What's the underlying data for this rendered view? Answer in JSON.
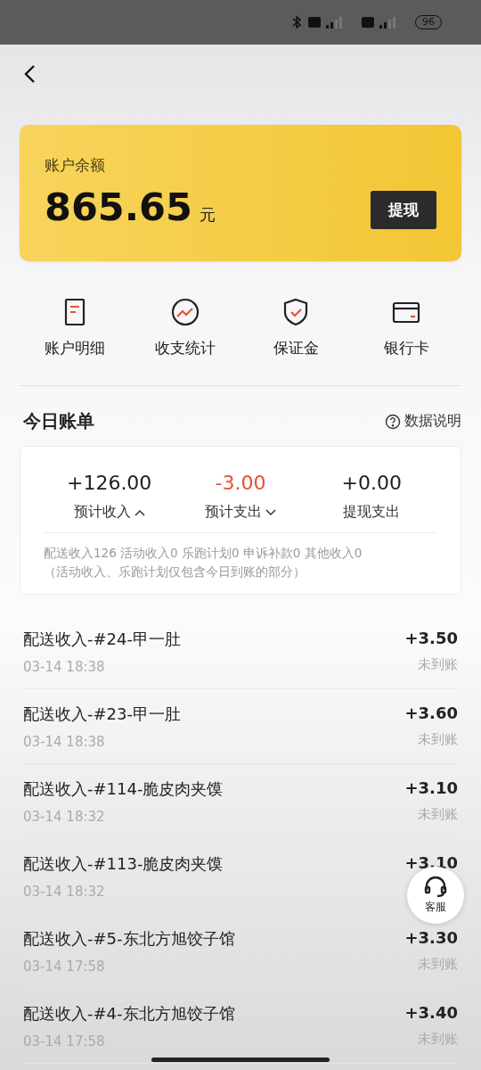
{
  "status_bar": {
    "battery": "96"
  },
  "balance_card": {
    "label": "账户余额",
    "amount": "865.65",
    "unit": "元",
    "button": "提现"
  },
  "shortcuts": [
    {
      "kind": "statement",
      "label": "账户明细"
    },
    {
      "kind": "stats",
      "label": "收支统计"
    },
    {
      "kind": "deposit",
      "label": "保证金"
    },
    {
      "kind": "card",
      "label": "银行卡"
    }
  ],
  "today": {
    "title": "今日账单",
    "help": "数据说明",
    "summary": [
      {
        "value": "+126.00",
        "label": "预计收入",
        "kind": "expandable",
        "expanded": true,
        "color": "#1f1f1f"
      },
      {
        "value": "-3.00",
        "label": "预计支出",
        "kind": "expandable",
        "expanded": false,
        "color": "#e8503a"
      },
      {
        "value": "+0.00",
        "label": "提现支出",
        "kind": "plain",
        "color": "#1f1f1f"
      }
    ],
    "breakdown": "配送收入126 活动收入0 乐跑计划0 申诉补款0 其他收入0",
    "note": "（活动收入、乐跑计划仅包含今日到账的部分）"
  },
  "transactions": [
    {
      "title": "配送收入-#24-甲一肚",
      "time": "03-14 18:38",
      "amount": "+3.50",
      "status": "未到账"
    },
    {
      "title": "配送收入-#23-甲一肚",
      "time": "03-14 18:38",
      "amount": "+3.60",
      "status": "未到账"
    },
    {
      "title": "配送收入-#114-脆皮肉夹馍",
      "time": "03-14 18:32",
      "amount": "+3.10",
      "status": "未到账"
    },
    {
      "title": "配送收入-#113-脆皮肉夹馍",
      "time": "03-14 18:32",
      "amount": "+3.10"
    },
    {
      "title": "配送收入-#5-东北方旭饺子馆",
      "time": "03-14 17:58",
      "amount": "+3.30",
      "status": "未到账"
    },
    {
      "title": "配送收入-#4-东北方旭饺子馆",
      "time": "03-14 17:58",
      "amount": "+3.40",
      "status": "未到账"
    }
  ],
  "support_button": {
    "label": "客服"
  }
}
